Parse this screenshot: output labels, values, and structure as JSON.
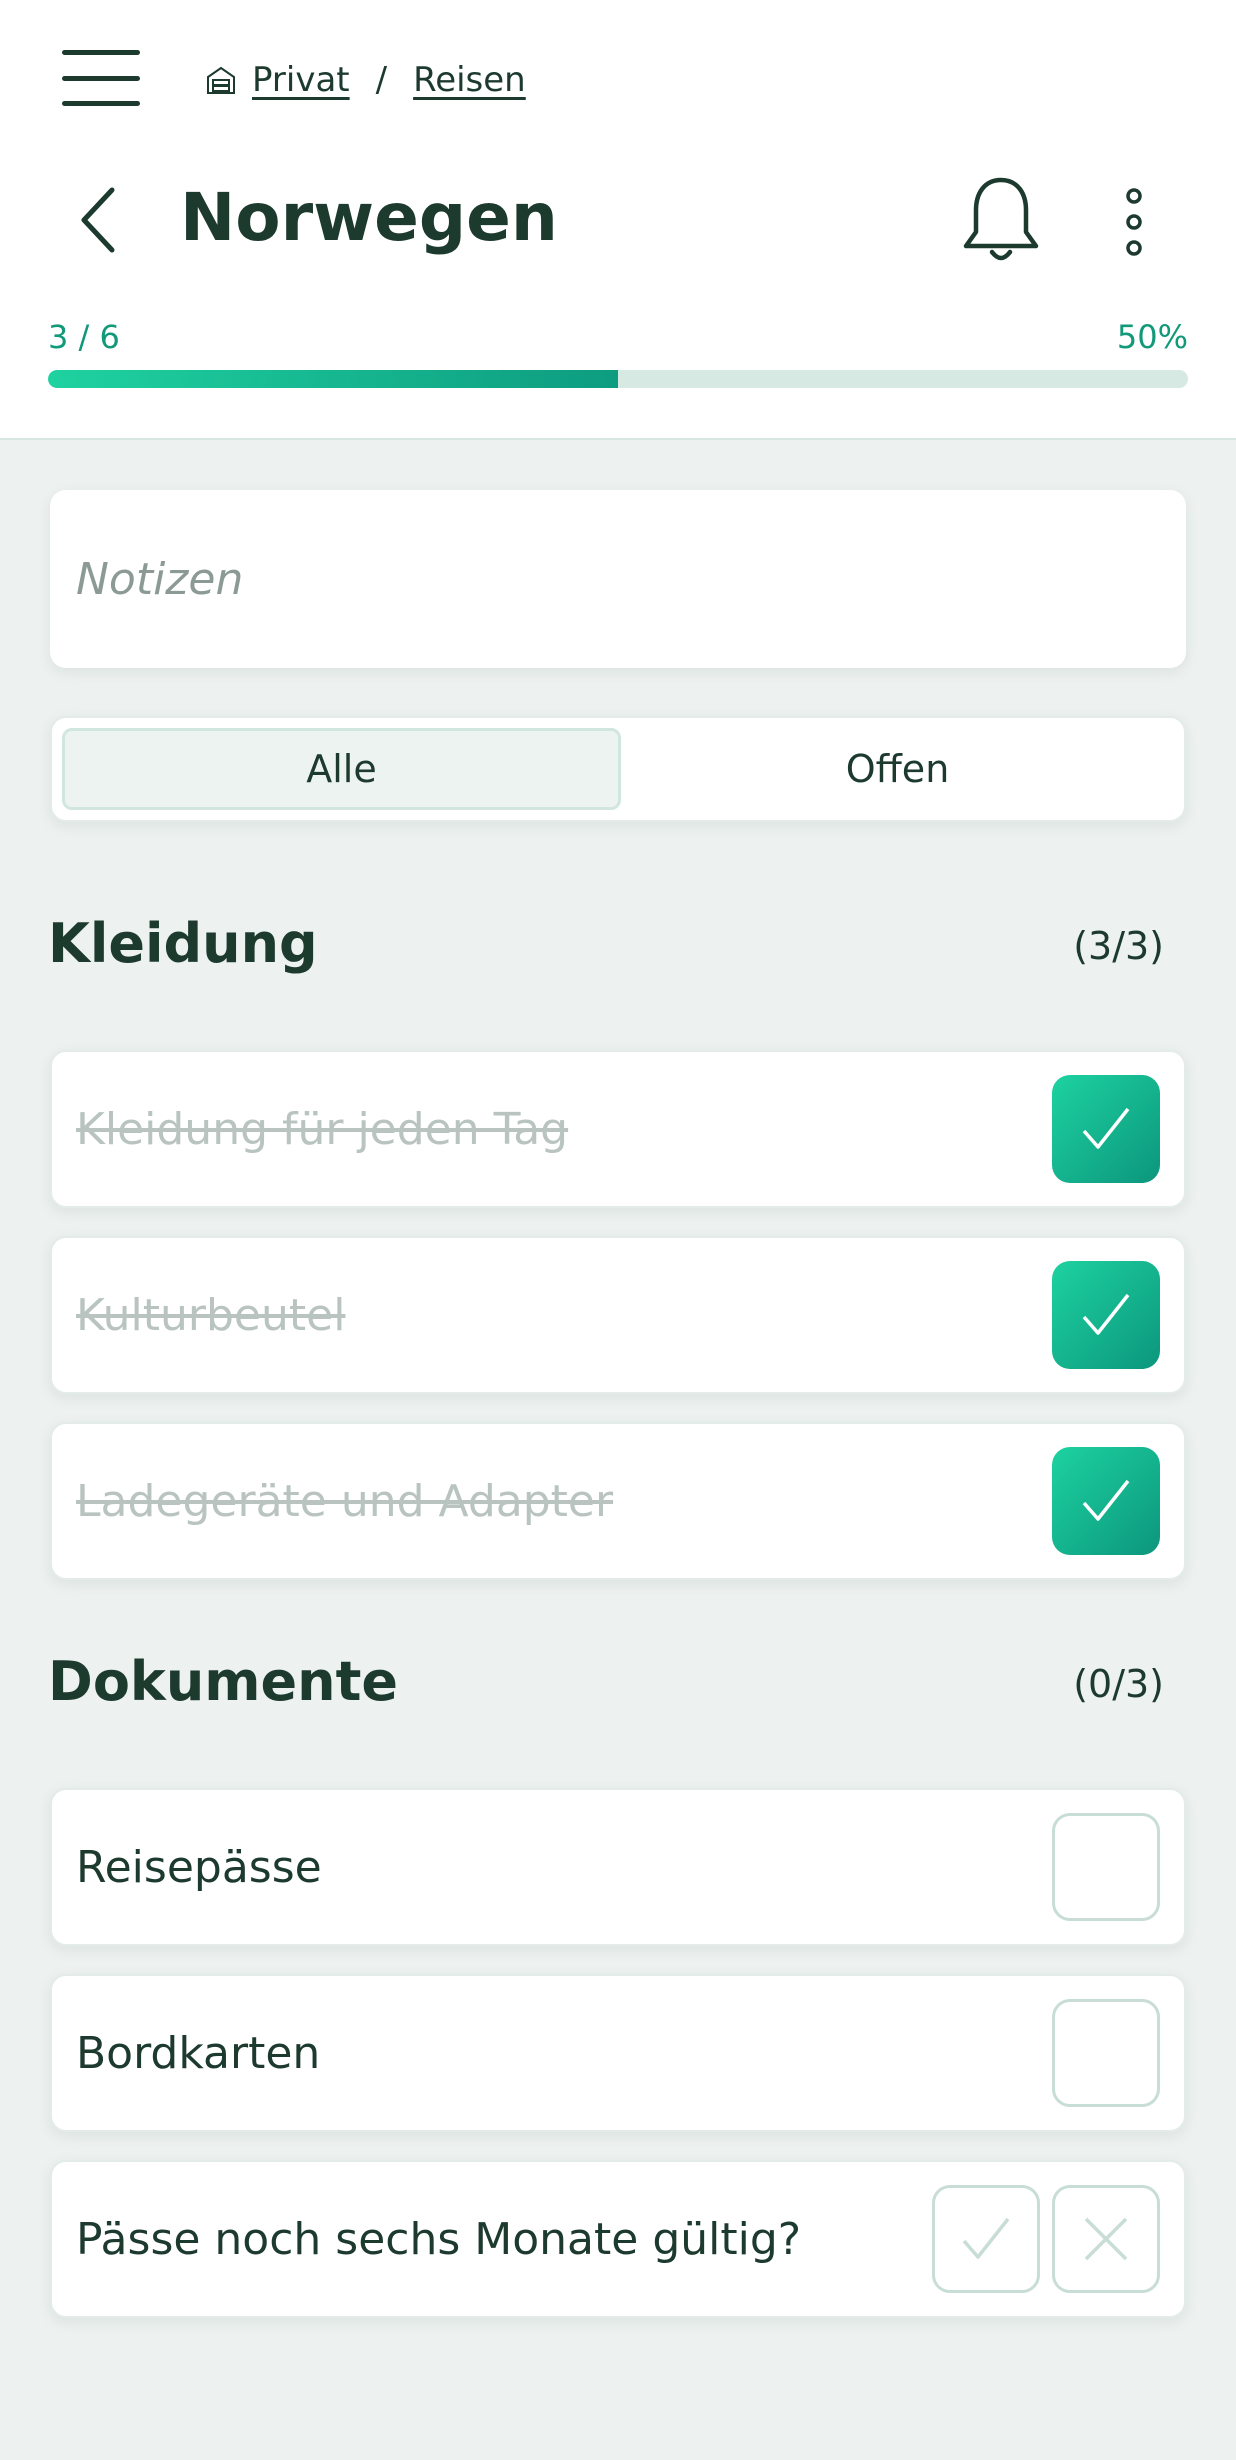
{
  "breadcrumb": {
    "home": "Privat",
    "separator": "/",
    "current": "Reisen"
  },
  "page": {
    "title": "Norwegen"
  },
  "progress": {
    "count": "3 / 6",
    "percent_label": "50%",
    "fraction": 0.5
  },
  "notes": {
    "placeholder": "Notizen"
  },
  "filter": {
    "all": "Alle",
    "open": "Offen"
  },
  "sections": [
    {
      "title": "Kleidung",
      "count": "(3/3)",
      "items": [
        {
          "label": "Kleidung für jeden Tag",
          "checked": true
        },
        {
          "label": "Kulturbeutel",
          "checked": true
        },
        {
          "label": "Ladegeräte und Adapter",
          "checked": true
        }
      ]
    },
    {
      "title": "Dokumente",
      "count": "(0/3)",
      "items": [
        {
          "label": "Reisepässe",
          "checked": false
        },
        {
          "label": "Bordkarten",
          "checked": false
        },
        {
          "label": "Pässe noch sechs Monate gültig?",
          "checked": false,
          "type": "yes-no"
        }
      ]
    }
  ],
  "colors": {
    "accent": "#12997a",
    "text": "#1d3a2f",
    "background": "#edf1f0"
  }
}
